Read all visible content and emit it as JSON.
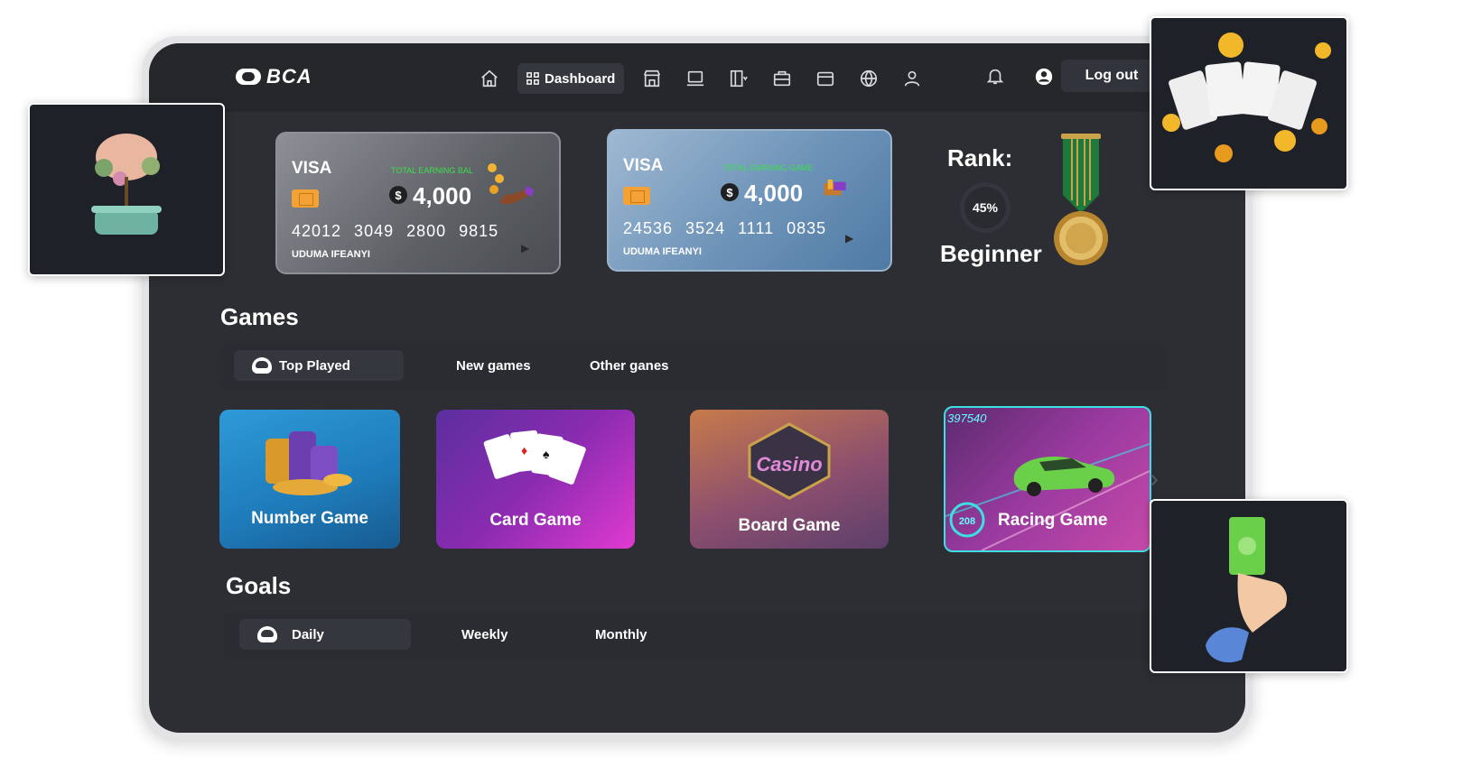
{
  "app": {
    "logo_text": "BCA"
  },
  "nav": {
    "dashboard_label": "Dashboard",
    "icons": [
      "home-icon",
      "dashboard-grid-icon",
      "store-icon",
      "laptop-icon",
      "ticket-dropdown-icon",
      "briefcase-icon",
      "wallet-icon",
      "globe-icon",
      "users-icon"
    ]
  },
  "header_tools": {
    "logout_label": "Log out"
  },
  "cards": [
    {
      "brand": "VISA",
      "balance_heading": "TOTAL EARNING BAL",
      "currency_symbol": "$",
      "amount": "4,000",
      "number": "42012 3049 2800 9815",
      "holder": "UDUMA IFEANYI"
    },
    {
      "brand": "VISA",
      "balance_heading": "TOTAL EARNING GAME",
      "currency_symbol": "$",
      "amount": "4,000",
      "number": "24536 3524 1111 0835",
      "holder": "UDUMA IFEANYI"
    }
  ],
  "rank": {
    "title": "Rank:",
    "progress_label": "45%",
    "progress": 0.45,
    "level": "Beginner"
  },
  "games": {
    "title": "Games",
    "tabs": [
      {
        "label": "Top Played",
        "active": true
      },
      {
        "label": "New games"
      },
      {
        "label": "Other ganes"
      }
    ],
    "tiles": [
      {
        "label": "Number Game"
      },
      {
        "label": "Card  Game"
      },
      {
        "label": "Board Game",
        "sign_text": "Casino"
      },
      {
        "label": "Racing Game",
        "score": "397540",
        "speed": "208"
      }
    ]
  },
  "goals": {
    "title": "Goals",
    "tabs": [
      {
        "label": "Daily",
        "active": true
      },
      {
        "label": "Weekly"
      },
      {
        "label": "Monthly"
      }
    ]
  },
  "colors": {
    "background": "#2c2e33",
    "topbar": "#25272b",
    "accent_green": "#3ce04c",
    "racing_border": "#3de0e0"
  }
}
